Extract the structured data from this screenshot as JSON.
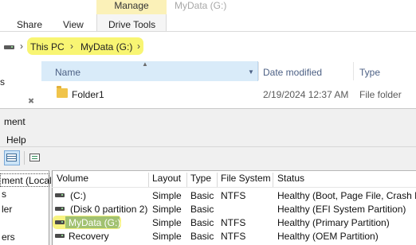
{
  "ribbon": {
    "context_header": "Manage",
    "window_title": "MyData (G:)",
    "tabs": [
      "Share",
      "View",
      "Drive Tools"
    ]
  },
  "address": {
    "crumbs": [
      "This PC",
      "MyData (G:)"
    ],
    "separator": "›"
  },
  "nav_pane": {
    "partial_label": "s"
  },
  "file_list": {
    "columns": [
      "Name",
      "Date modified",
      "Type"
    ],
    "rows": [
      {
        "name": "Folder1",
        "date": "2/19/2024 12:37 AM",
        "type": "File folder"
      }
    ]
  },
  "disk_mgmt": {
    "menu": [
      "ment",
      "Help"
    ],
    "tree": [
      "ment (Local",
      "s",
      "ler",
      "ers"
    ],
    "volume_columns": [
      "Volume",
      "Layout",
      "Type",
      "File System",
      "Status"
    ],
    "volumes": [
      {
        "volume": "(C:)",
        "layout": "Simple",
        "type": "Basic",
        "fs": "NTFS",
        "status": "Healthy (Boot, Page File, Crash D"
      },
      {
        "volume": "(Disk 0 partition 2)",
        "layout": "Simple",
        "type": "Basic",
        "fs": "",
        "status": "Healthy (EFI System Partition)"
      },
      {
        "volume": "MyData (G:)",
        "layout": "Simple",
        "type": "Basic",
        "fs": "NTFS",
        "status": "Healthy (Primary Partition)"
      },
      {
        "volume": "Recovery",
        "layout": "Simple",
        "type": "Basic",
        "fs": "NTFS",
        "status": "Healthy (OEM Partition)"
      }
    ]
  },
  "colors": {
    "highlight": "#f7f35a",
    "selection": "#0a6fd0",
    "header_selected": "#d9ebf9",
    "context_tab": "#fbf1b8"
  },
  "icons": [
    "drive-icon",
    "chevron-right-icon",
    "chevron-up-icon",
    "chevron-down-icon",
    "folder-icon",
    "pin-icon",
    "graphical-view-icon",
    "list-view-icon",
    "volume-icon"
  ]
}
